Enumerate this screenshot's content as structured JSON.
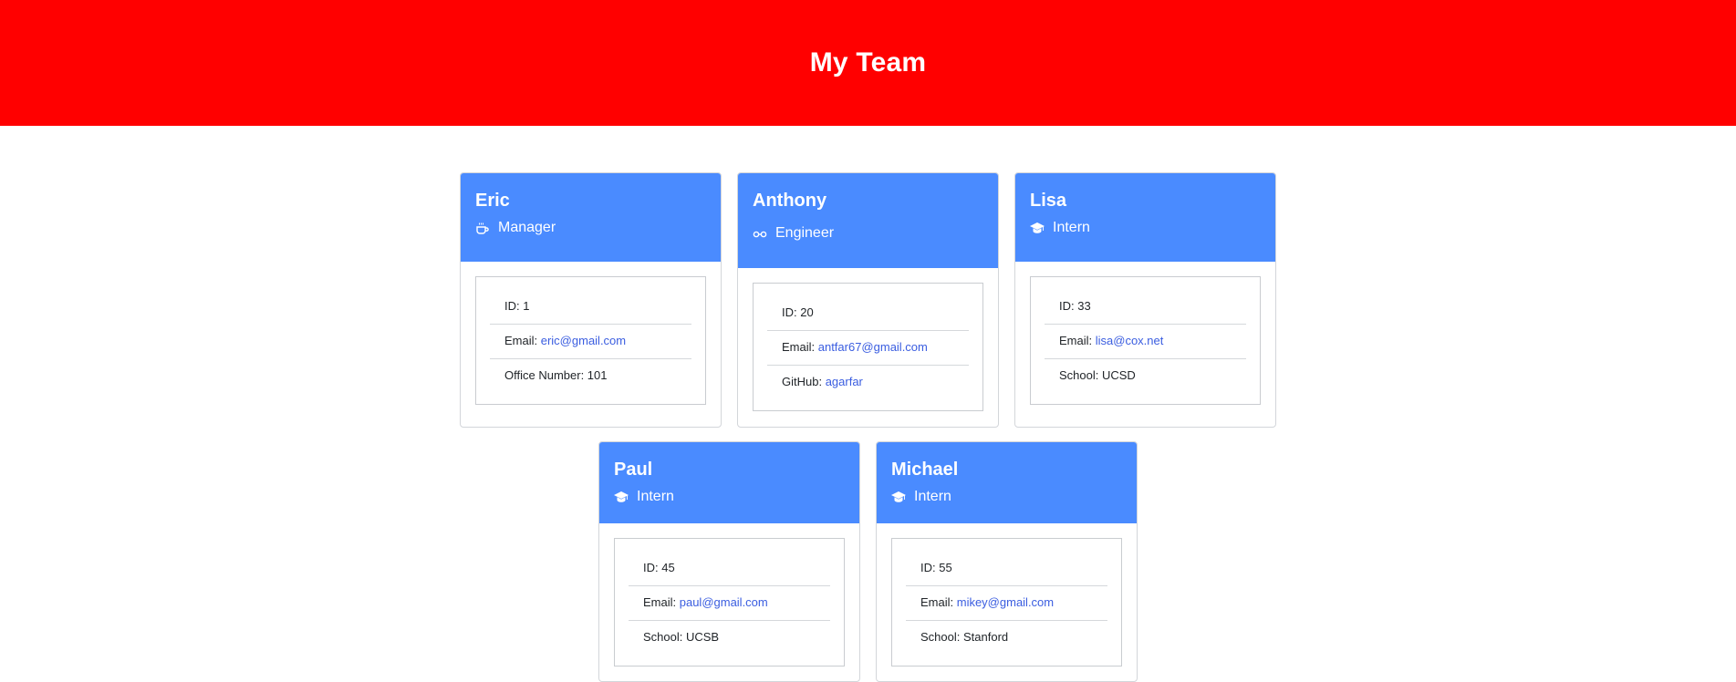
{
  "page": {
    "title": "My Team",
    "header_color": "#ff0000",
    "card_header_color": "#4a8bff",
    "link_color": "#3a5de0"
  },
  "members": [
    {
      "name": "Eric",
      "role": "Manager",
      "icon": "coffee-icon",
      "id_label": "ID: ",
      "id": "1",
      "email_label": "Email: ",
      "email": "eric@gmail.com",
      "extra_label": "Office Number: ",
      "extra_value": "101"
    },
    {
      "name": "Anthony",
      "role": "Engineer",
      "icon": "glasses-icon",
      "id_label": "ID: ",
      "id": "20",
      "email_label": "Email: ",
      "email": "antfar67@gmail.com",
      "extra_label": "GitHub: ",
      "extra_value": "agarfar"
    },
    {
      "name": "Lisa",
      "role": "Intern",
      "icon": "graduation-cap-icon",
      "id_label": "ID: ",
      "id": "33",
      "email_label": "Email: ",
      "email": "lisa@cox.net",
      "extra_label": "School: ",
      "extra_value": "UCSD"
    },
    {
      "name": "Paul",
      "role": "Intern",
      "icon": "graduation-cap-icon",
      "id_label": "ID: ",
      "id": "45",
      "email_label": "Email: ",
      "email": "paul@gmail.com",
      "extra_label": "School: ",
      "extra_value": "UCSB"
    },
    {
      "name": "Michael",
      "role": "Intern",
      "icon": "graduation-cap-icon",
      "id_label": "ID: ",
      "id": "55",
      "email_label": "Email: ",
      "email": "mikey@gmail.com",
      "extra_label": "School: ",
      "extra_value": "Stanford"
    }
  ]
}
